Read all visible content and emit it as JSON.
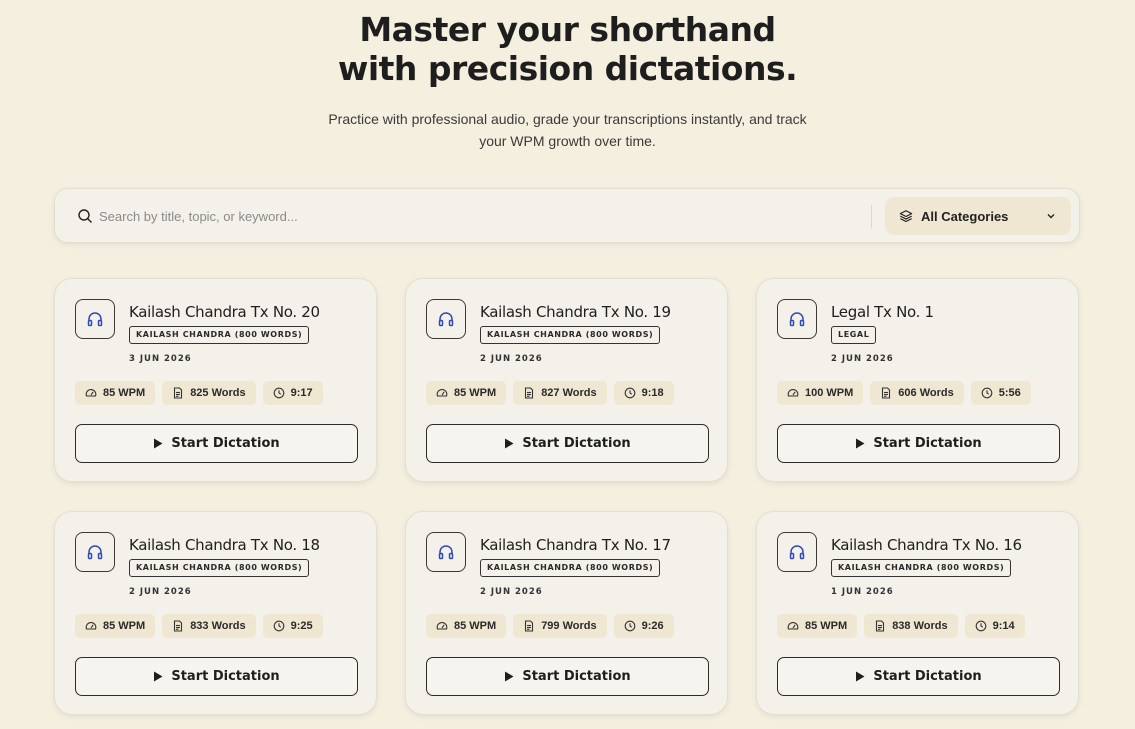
{
  "hero": {
    "title_line1": "Master your shorthand",
    "title_line2": "with precision dictations.",
    "subtitle": "Practice with professional audio, grade your transcriptions instantly, and track your WPM growth over time."
  },
  "search": {
    "placeholder": "Search by title, topic, or keyword...",
    "value": "",
    "category_label": "All Categories"
  },
  "colors": {
    "accent_blue": "#2f49b8",
    "background": "#f4efdf",
    "card": "#f3f1ea",
    "chip": "#efe7d2"
  },
  "cards": [
    {
      "title": "Kailash Chandra Tx No. 20",
      "tag": "KAILASH CHANDRA (800 WORDS)",
      "date": "3 JUN 2026",
      "wpm": "85 WPM",
      "words": "825 Words",
      "duration": "9:17",
      "button": "Start Dictation"
    },
    {
      "title": "Kailash Chandra Tx No. 19",
      "tag": "KAILASH CHANDRA (800 WORDS)",
      "date": "2 JUN 2026",
      "wpm": "85 WPM",
      "words": "827 Words",
      "duration": "9:18",
      "button": "Start Dictation"
    },
    {
      "title": "Legal Tx No. 1",
      "tag": "LEGAL",
      "date": "2 JUN 2026",
      "wpm": "100 WPM",
      "words": "606 Words",
      "duration": "5:56",
      "button": "Start Dictation"
    },
    {
      "title": "Kailash Chandra Tx No. 18",
      "tag": "KAILASH CHANDRA (800 WORDS)",
      "date": "2 JUN 2026",
      "wpm": "85 WPM",
      "words": "833 Words",
      "duration": "9:25",
      "button": "Start Dictation"
    },
    {
      "title": "Kailash Chandra Tx No. 17",
      "tag": "KAILASH CHANDRA (800 WORDS)",
      "date": "2 JUN 2026",
      "wpm": "85 WPM",
      "words": "799 Words",
      "duration": "9:26",
      "button": "Start Dictation"
    },
    {
      "title": "Kailash Chandra Tx No. 16",
      "tag": "KAILASH CHANDRA (800 WORDS)",
      "date": "1 JUN 2026",
      "wpm": "85 WPM",
      "words": "838 Words",
      "duration": "9:14",
      "button": "Start Dictation"
    }
  ]
}
